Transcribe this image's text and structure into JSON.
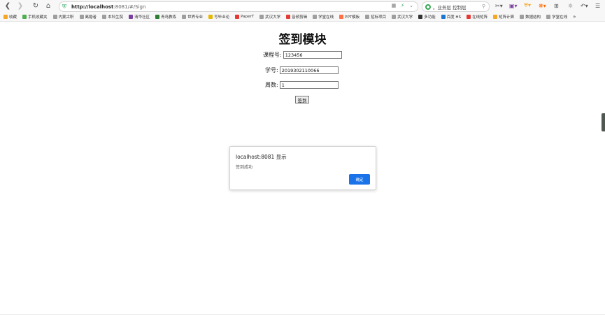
{
  "browser": {
    "url_host": "http://localhost",
    "url_rest": ":8081/#/Sign",
    "search_text": "。业务层 控制层",
    "bookmarks": [
      {
        "label": "收藏",
        "color": "#f5a623"
      },
      {
        "label": "手机收藏夹",
        "color": "#4caf50"
      },
      {
        "label": "内蒙古职",
        "color": "#9e9e9e"
      },
      {
        "label": "离婚者",
        "color": "#9e9e9e"
      },
      {
        "label": "本科生院",
        "color": "#9e9e9e"
      },
      {
        "label": "清华社区",
        "color": "#7b3fa0"
      },
      {
        "label": "青岛教练",
        "color": "#2e7d32"
      },
      {
        "label": "世界专业",
        "color": "#9e9e9e"
      },
      {
        "label": "写毕业论",
        "color": "#e6b800"
      },
      {
        "label": "PaperT",
        "color": "#e53935"
      },
      {
        "label": "武汉大学",
        "color": "#9e9e9e"
      },
      {
        "label": "音频剪辑",
        "color": "#e53935"
      },
      {
        "label": "学堂在线",
        "color": "#9e9e9e"
      },
      {
        "label": "PPT模板",
        "color": "#ff7043"
      },
      {
        "label": "招标项目",
        "color": "#9e9e9e"
      },
      {
        "label": "武汉大学",
        "color": "#9e9e9e"
      },
      {
        "label": "多功能",
        "color": "#333333"
      },
      {
        "label": "百度 HS",
        "color": "#1976d2"
      },
      {
        "label": "在线矩阵",
        "color": "#e53935"
      },
      {
        "label": "矩阵计算",
        "color": "#f5a623"
      },
      {
        "label": "数据结构",
        "color": "#9e9e9e"
      },
      {
        "label": "学堂在线",
        "color": "#9e9e9e"
      }
    ]
  },
  "page": {
    "title": "签到模块",
    "course_label": "课程号:",
    "course_value": "123456",
    "student_label": "学号:",
    "student_value": "2019302110066",
    "week_label": "周数:",
    "week_value": "1",
    "sign_button": "签到"
  },
  "dialog": {
    "title": "localhost:8081 显示",
    "message": "签到成功",
    "ok_label": "确定"
  }
}
